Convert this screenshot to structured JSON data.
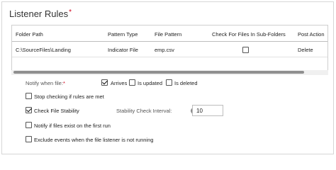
{
  "section": {
    "title": "Listener Rules",
    "required_mark": "*"
  },
  "table": {
    "headers": [
      "Folder Path",
      "Pattern Type",
      "File Pattern",
      "Check For Files In Sub-Folders",
      "Post Action"
    ],
    "rows": [
      {
        "folder_path": "C:\\SourceFiles\\Landing",
        "pattern_type": "Indicator File",
        "file_pattern": "emp.csv",
        "check_subfolders": false,
        "post_action": "Delete"
      }
    ]
  },
  "notify": {
    "label": "Notify when file:",
    "required_mark": "*",
    "options": [
      {
        "label": "Arrives",
        "checked": true
      },
      {
        "label": "Is updated",
        "checked": false
      },
      {
        "label": "Is deleted",
        "checked": false
      }
    ]
  },
  "options": {
    "stop_checking": {
      "label": "Stop checking if rules are met",
      "checked": false
    },
    "check_stability": {
      "label": "Check File Stability",
      "checked": true
    },
    "stability_interval": {
      "label": "Stability Check Interval:",
      "value": "10"
    },
    "notify_first_run": {
      "label": "Notify if files exist on the first run",
      "checked": false
    },
    "exclude_events": {
      "label": "Exclude events when the file listener is not running",
      "checked": false
    }
  },
  "icons": {
    "info": "info-icon",
    "checkbox": "checkbox-icon"
  }
}
